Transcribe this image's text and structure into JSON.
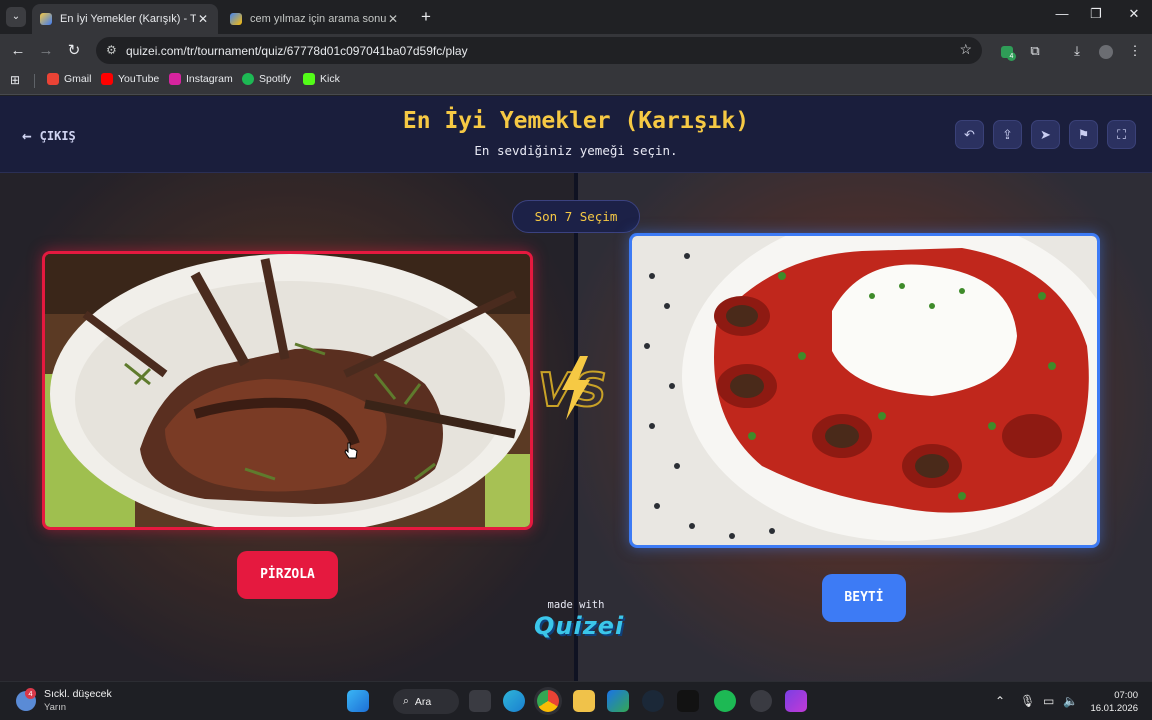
{
  "browser": {
    "tabs": [
      {
        "title": "En İyi Yemekler (Karışık) - Tier Li",
        "active": true
      },
      {
        "title": "cem yılmaz için arama sonuçları",
        "active": false
      }
    ],
    "url": "quizei.com/tr/tournament/quiz/67778d01c097041ba07d59fc/play",
    "extension_badge": "4",
    "bookmarks": [
      {
        "label": "Gmail",
        "color": "#ea4335"
      },
      {
        "label": "YouTube",
        "color": "#ff0000"
      },
      {
        "label": "Instagram",
        "color": "#d6249f"
      },
      {
        "label": "Spotify",
        "color": "#1db954"
      },
      {
        "label": "Kick",
        "color": "#53fc18"
      }
    ]
  },
  "page": {
    "back_label": "ÇIKIŞ",
    "title": "En İyi Yemekler (Karışık)",
    "subtitle": "En sevdiğiniz yemeği seçin.",
    "round_label": "Son 7 Seçim",
    "left_choice": "PİRZOLA",
    "right_choice": "BEYTİ",
    "made_with": "made with",
    "brand": "QUIZEI",
    "colors": {
      "accent_yellow": "#f6c944",
      "left_red": "#e5193f",
      "right_blue": "#3d7bf5",
      "header_bg": "#1a1e3c"
    }
  },
  "taskbar": {
    "weather_title": "Sıckl. düşecek",
    "weather_sub": "Yarın",
    "weather_badge": "4",
    "search_label": "Ara",
    "time": "07:00",
    "date": "16.01.2026"
  }
}
